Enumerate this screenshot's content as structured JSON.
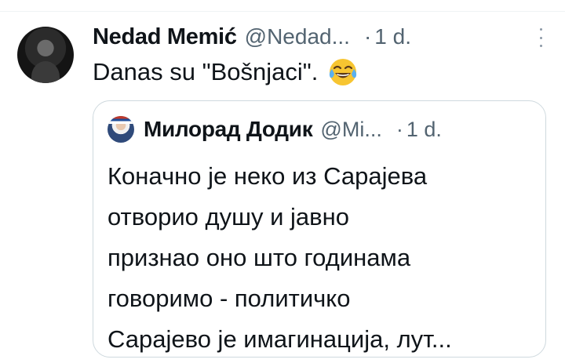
{
  "tweet": {
    "author_name": "Nedad Memić",
    "author_handle": "@Nedad...",
    "separator": "·",
    "time": "1 d.",
    "text": "Danas su \"Bošnjaci\".",
    "emoji": "face-with-tears-of-joy-icon",
    "more_icon": "more-vertical-icon"
  },
  "quoted_tweet": {
    "author_name": "Милорад Додик",
    "author_handle": "@Mi...",
    "separator": "·",
    "time": "1 d.",
    "lines": [
      "Коначно је неко из Сарајева",
      "отворио душу и јавно",
      "признао оно што годинама",
      "говоримо - политичко",
      "Сарајево је имагинација, лут..."
    ]
  },
  "colors": {
    "text_primary": "#0f1419",
    "text_secondary": "#536471",
    "border": "#cfd9de",
    "emoji_face": "#f7c531"
  }
}
